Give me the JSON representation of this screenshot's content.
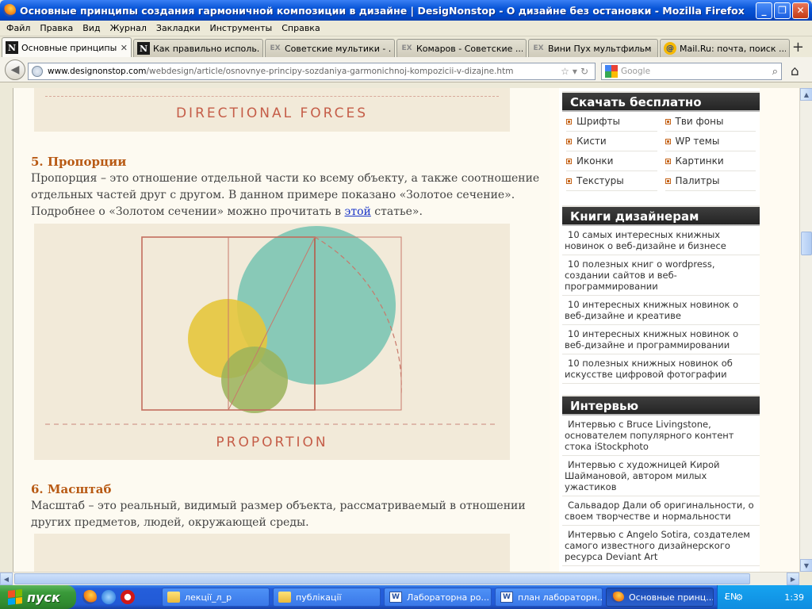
{
  "window": {
    "title": "Основные принципы создания гармоничной композиции в дизайне | DesigNonstop - О дизайне без остановки - Mozilla Firefox"
  },
  "menu": [
    "Файл",
    "Правка",
    "Вид",
    "Журнал",
    "Закладки",
    "Инструменты",
    "Справка"
  ],
  "tabs": [
    {
      "label": "Основные принципы с...",
      "icon": "N"
    },
    {
      "label": "Как правильно исполь...",
      "icon": "N"
    },
    {
      "label": "Советские мультики - ...",
      "icon": "EX"
    },
    {
      "label": "Комаров - Советские ...",
      "icon": "EX"
    },
    {
      "label": "Вини Пух мультфильм ...",
      "icon": "EX"
    },
    {
      "label": "Mail.Ru: почта, поиск ...",
      "icon": "@"
    }
  ],
  "url": {
    "domain": "www.designonstop.com",
    "path": "/webdesign/article/osnovnye-principy-sozdaniya-garmonichnoj-kompozicii-v-dizajne.htm"
  },
  "search": {
    "placeholder": "Google"
  },
  "article": {
    "top_caption": "DIRECTIONAL FORCES",
    "section5_title": "5. Пропорции",
    "section5_text_a": "Пропорция – это отношение отдельной части ко всему объекту, а также соотношение отдельных частей друг с другом. В данном примере показано «Золотое сечение». Подробнее о «Золотом сечении» можно прочитать в ",
    "section5_link": "этой",
    "section5_text_b": " статье».",
    "proportion_caption": "PROPORTION",
    "section6_title": "6. Масштаб",
    "section6_text": "Масштаб – это реальный, видимый размер объекта, рассматриваемый в отношении других предметов, людей, окружающей среды."
  },
  "sidebar": {
    "download": {
      "title": "Скачать бесплатно",
      "items": [
        "Шрифты",
        "Тви фоны",
        "Кисти",
        "WP темы",
        "Иконки",
        "Картинки",
        "Текстуры",
        "Палитры"
      ]
    },
    "books": {
      "title": "Книги дизайнерам",
      "items": [
        "10 самых интересных книжных новинок о веб-дизайне и бизнесе",
        "10 полезных книг о wordpress, создании сайтов и веб-программировании",
        "10 интересных книжных новинок о веб-дизайне и креативе",
        "10 интересных книжных новинок о веб-дизайне и программировании",
        "10 полезных книжных новинок об искусстве цифровой фотографии"
      ]
    },
    "interview": {
      "title": "Интервью",
      "items": [
        "Интервью с Bruce Livingstone, основателем популярного контент стока iStockphoto",
        "Интервью с художницей Кирой Шаймановой, автором милых ужастиков",
        "Сальвадор Дали об оригинальности, о своем творчестве и нормальности",
        "Интервью с Angelo Sotira, создателем самого известного дизайнерского ресурса Deviant Art"
      ]
    }
  },
  "taskbar": {
    "start": "пуск",
    "tasks": [
      "лекції_л_р",
      "публікації",
      "Лабораторна ро...",
      "план лабораторн...",
      "Основные принц..."
    ],
    "lang": "EN",
    "clock": "1:39"
  },
  "colors": {
    "accent_orange": "#b85a14",
    "link_blue": "#1733c8",
    "widget_header": "#2b2b2b",
    "circle_teal": "#7cc5b2",
    "circle_yellow": "#e6c63c",
    "circle_green": "#9bb35a"
  }
}
